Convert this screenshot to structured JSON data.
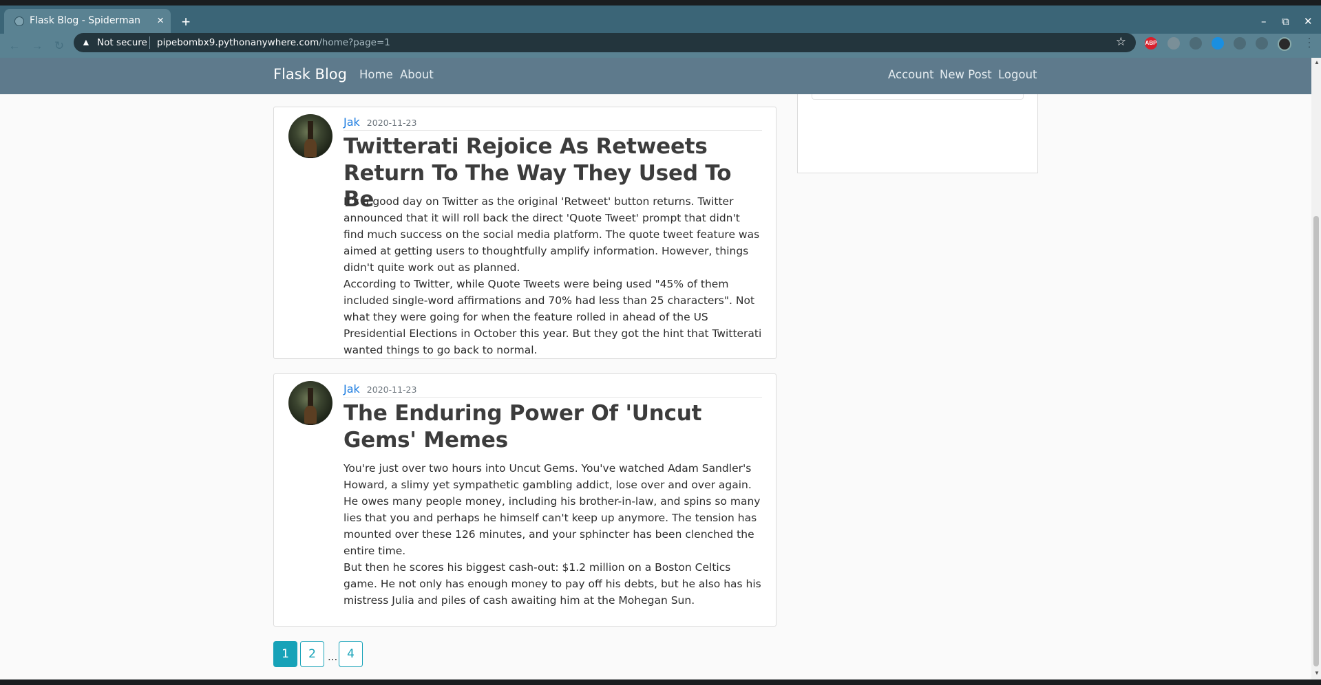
{
  "browser": {
    "tab_title": "Flask Blog - Spiderman",
    "tab_close": "×",
    "new_tab": "+",
    "window_minimize": "–",
    "window_restore": "⧉",
    "window_close": "✕",
    "security_label": "Not secure",
    "url_host": "pipebombx9.pythonanywhere.com",
    "url_path": "/home?page=1",
    "bookmark_icon": "☆",
    "extensions": [
      {
        "name": "adblock-icon",
        "text": "ABP",
        "color": "#d9202c"
      },
      {
        "name": "extension-cloud-icon",
        "text": "",
        "color": "#7a8f98"
      },
      {
        "name": "extension-translate-icon",
        "text": "",
        "color": "#4d6b77"
      },
      {
        "name": "extension-blue-icon",
        "text": "",
        "color": "#1a8fe0"
      },
      {
        "name": "extension-puzzle-icon",
        "text": "",
        "color": "#4d6b77"
      },
      {
        "name": "extension-list-icon",
        "text": "",
        "color": "#4d6b77"
      }
    ]
  },
  "site": {
    "brand": "Flask Blog",
    "nav_left": [
      "Home",
      "About"
    ],
    "nav_right": [
      "Account",
      "New Post",
      "Logout"
    ]
  },
  "posts": [
    {
      "author": "Jak",
      "date": "2020-11-23",
      "title": "Twitterati Rejoice As Retweets Return To The Way They Used To Be",
      "paragraphs": [
        "It's a good day on Twitter as the original 'Retweet' button returns. Twitter announced that it will roll back the direct 'Quote Tweet' prompt that didn't find much success on the social media platform. The quote tweet feature was aimed at getting users to thoughtfully amplify information. However, things didn't quite work out as planned.",
        "According to Twitter, while Quote Tweets were being used \"45% of them included single-word affirmations and 70% had less than 25 characters\". Not what they were going for when the feature rolled in ahead of the US Presidential Elections in October this year. But they got the hint that Twitterati wanted things to go back to normal."
      ]
    },
    {
      "author": "Jak",
      "date": "2020-11-23",
      "title": "The Enduring Power Of 'Uncut Gems' Memes",
      "paragraphs": [
        "You're just over two hours into Uncut Gems. You've watched Adam Sandler's Howard, a slimy yet sympathetic gambling addict, lose over and over again. He owes many people money, including his brother-in-law, and spins so many lies that you and perhaps he himself can't keep up anymore. The tension has mounted over these 126 minutes, and your sphincter has been clenched the entire time.",
        "But then he scores his biggest cash-out: $1.2 million on a Boston Celtics game. He not only has enough money to pay off his debts, but he also has his mistress Julia and piles of cash awaiting him at the Mohegan Sun."
      ]
    }
  ],
  "pagination": {
    "pages": [
      "1",
      "2",
      "4"
    ],
    "ellipsis": "...",
    "current": "1"
  },
  "colors": {
    "tab_bar": "#3b6577",
    "navbar": "#5e7a8c",
    "link": "#1a7be0",
    "pagination": "#17a2b8"
  }
}
